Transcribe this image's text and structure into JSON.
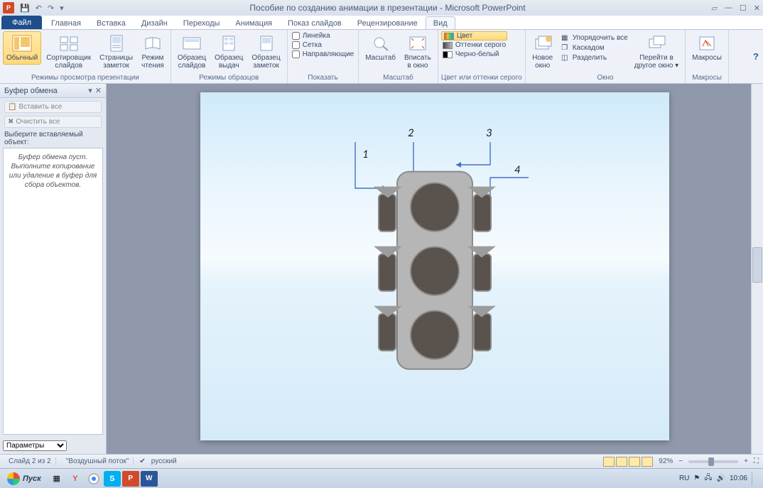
{
  "title": "Пособие по созданию анимации в презентации - Microsoft PowerPoint",
  "app_icon_letter": "P",
  "tabs": {
    "file": "Файл",
    "items": [
      "Главная",
      "Вставка",
      "Дизайн",
      "Переходы",
      "Анимация",
      "Показ слайдов",
      "Рецензирование",
      "Вид"
    ],
    "active_index": 7
  },
  "ribbon": {
    "g1": {
      "label": "Режимы просмотра презентации",
      "btns": [
        "Обычный",
        "Сортировщик\nслайдов",
        "Страницы\nзаметок",
        "Режим\nчтения"
      ]
    },
    "g2": {
      "label": "Режимы образцов",
      "btns": [
        "Образец\nслайдов",
        "Образец\nвыдач",
        "Образец\nзаметок"
      ]
    },
    "g3": {
      "label": "Показать",
      "checks": [
        "Линейка",
        "Сетка",
        "Направляющие"
      ]
    },
    "g4": {
      "label": "Масштаб",
      "btns": [
        "Масштаб",
        "Вписать\nв окно"
      ]
    },
    "g5": {
      "label": "Цвет или оттенки серого",
      "opts": [
        "Цвет",
        "Оттенки серого",
        "Черно-белый"
      ]
    },
    "g6": {
      "label": "Окно",
      "btn1": "Новое\nокно",
      "small": [
        "Упорядочить все",
        "Каскадом",
        "Разделить"
      ],
      "btn2": "Перейти в\nдругое окно"
    },
    "g7": {
      "label": "Макросы",
      "btn": "Макросы"
    }
  },
  "panel": {
    "title": "Буфер обмена",
    "btn_paste_all": "Вставить все",
    "btn_clear_all": "Очистить все",
    "select_label": "Выберите вставляемый объект:",
    "body": "Буфер обмена пуст.\nВыполните копирование или удаление в буфер для сбора объектов.",
    "params": "Параметры"
  },
  "callouts": {
    "n1": "1",
    "n2": "2",
    "n3": "3",
    "n4": "4"
  },
  "status": {
    "slide": "Слайд 2 из 2",
    "theme": "\"Воздушный поток\"",
    "lang": "русский",
    "zoom": "92%"
  },
  "taskbar": {
    "start": "Пуск",
    "lang_ind": "RU",
    "time": "10:06"
  }
}
